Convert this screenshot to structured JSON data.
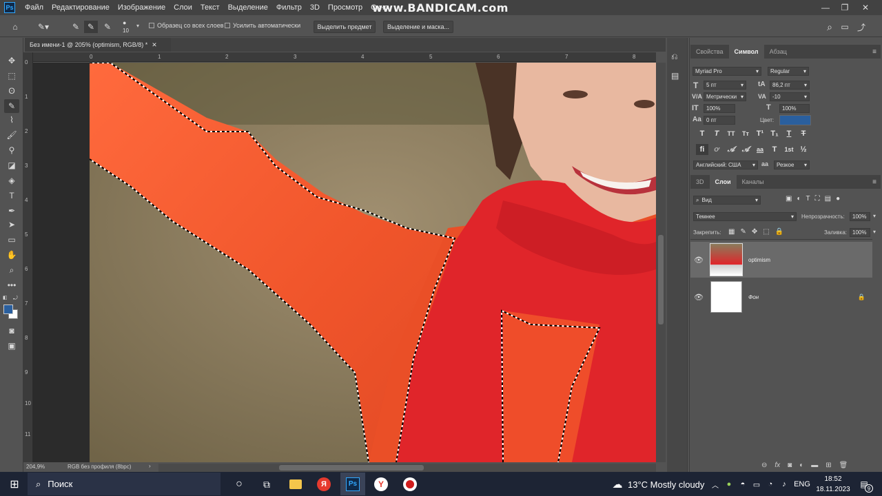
{
  "menubar": {
    "items": [
      "Файл",
      "Редактирование",
      "Изображение",
      "Слои",
      "Текст",
      "Выделение",
      "Фильтр",
      "3D",
      "Просмотр",
      "Окно"
    ],
    "watermark": "www.BANDICAM.com"
  },
  "options": {
    "brush_size": "10",
    "sample_all_layers": "Образец со всех слоев",
    "auto_enhance": "Усилить автоматически",
    "select_subject_button": "Выделить предмет",
    "select_mask_button": "Выделение и маска..."
  },
  "document": {
    "tab_title": "Без имени-1 @ 205% (optimism, RGB/8) *",
    "ruler_top": [
      "0",
      "1",
      "2",
      "3",
      "4",
      "5",
      "6",
      "7",
      "8"
    ],
    "ruler_left": [
      "0",
      "1",
      "2",
      "3",
      "4",
      "5",
      "6",
      "7",
      "8",
      "9",
      "10",
      "11"
    ],
    "zoom": "204,9%",
    "profile": "RGB без профиля (8bpc)"
  },
  "character_panel": {
    "tabs": [
      "Свойства",
      "Символ",
      "Абзац"
    ],
    "active_tab": "Символ",
    "font_family": "Myriad Pro",
    "font_style": "Regular",
    "font_size": "5 пт",
    "leading": "86,2 пт",
    "kerning": "Метрически",
    "tracking": "-10",
    "vertical_scale": "100%",
    "horizontal_scale": "100%",
    "baseline_shift": "0 пт",
    "color_label": "Цвет:",
    "text_color": "#2a5f9e",
    "language": "Английский: США",
    "antialias": "Резкое"
  },
  "layers_panel": {
    "tabs": [
      "3D",
      "Слои",
      "Каналы"
    ],
    "active_tab": "Слои",
    "filter_kind": "Вид",
    "blend_mode": "Темнее",
    "opacity_label": "Непрозрачность:",
    "opacity": "100%",
    "lock_label": "Закрепить:",
    "fill_label": "Заливка:",
    "fill": "100%",
    "layers": [
      {
        "name": "optimism",
        "selected": true,
        "locked": false
      },
      {
        "name": "Фон",
        "selected": false,
        "locked": true
      }
    ]
  },
  "taskbar": {
    "search_placeholder": "Поиск",
    "weather": "13°C  Mostly cloudy",
    "language": "ENG",
    "time": "18:52",
    "date": "18.11.2023",
    "notification_count": "9"
  }
}
